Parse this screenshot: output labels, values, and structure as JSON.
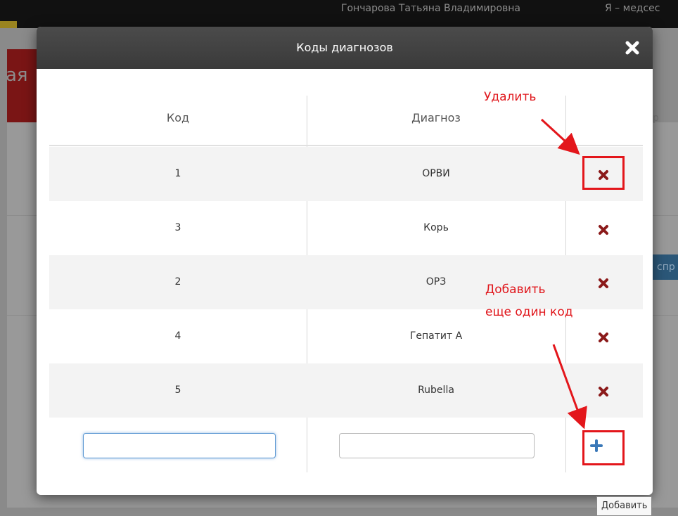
{
  "background": {
    "user_name": "Гончарова Татьяна Владимировна",
    "user_role": "Я – медсес",
    "page_title_fragment": "ая",
    "button_fragment": "спр",
    "side_text_fragment": "р"
  },
  "modal": {
    "title": "Коды диагнозов",
    "close_icon": "close-x-icon",
    "columns": {
      "code": "Код",
      "diagnosis": "Диагноз"
    },
    "rows": [
      {
        "code": "1",
        "diagnosis": "ОРВИ"
      },
      {
        "code": "3",
        "diagnosis": "Корь"
      },
      {
        "code": "2",
        "diagnosis": "ОРЗ"
      },
      {
        "code": "4",
        "diagnosis": "Гепатит А"
      },
      {
        "code": "5",
        "diagnosis": "Rubella"
      }
    ],
    "new_row": {
      "code_value": "",
      "diagnosis_value": ""
    },
    "add_tooltip": "Добавить"
  },
  "annotations": {
    "delete_label": "Удалить",
    "add_label_line1": "Добавить",
    "add_label_line2": "еще один код"
  },
  "colors": {
    "header_bg": "#3f3f3f",
    "delete_icon": "#8b1a1a",
    "add_icon": "#3a78b8",
    "annotation_red": "#e3161b"
  }
}
